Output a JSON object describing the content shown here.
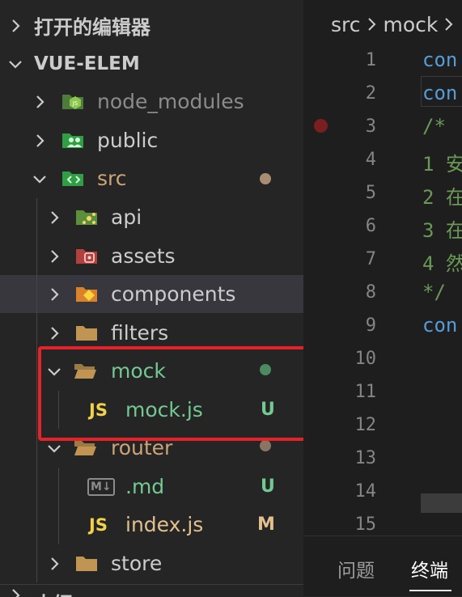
{
  "sidebar": {
    "open_editors_label": "打开的编辑器",
    "project_label": "VUE-ELEM",
    "outline_label": "大纲",
    "items": [
      {
        "label": "node_modules",
        "color": "#8b8b8b"
      },
      {
        "label": "public",
        "color": "#cccccc"
      },
      {
        "label": "src",
        "color": "#cca477"
      },
      {
        "label": "api",
        "color": "#cccccc"
      },
      {
        "label": "assets",
        "color": "#cccccc"
      },
      {
        "label": "components",
        "color": "#cccccc"
      },
      {
        "label": "filters",
        "color": "#cccccc"
      },
      {
        "label": "mock",
        "color": "#73c991"
      },
      {
        "label": "mock.js",
        "color": "#73c991",
        "icon_text": "JS",
        "status": "U"
      },
      {
        "label": "router",
        "color": "#cca477"
      },
      {
        "label": ".md",
        "color": "#73c991",
        "icon_text": "M↓",
        "status": "U"
      },
      {
        "label": "index.js",
        "color": "#e2c08d",
        "icon_text": "JS",
        "status": "M"
      },
      {
        "label": "store",
        "color": "#cccccc"
      }
    ]
  },
  "editor": {
    "breadcrumb": [
      "src",
      "mock"
    ],
    "line_numbers": [
      "1",
      "2",
      "3",
      "4",
      "5",
      "6",
      "7",
      "8",
      "9",
      "10",
      "11",
      "12",
      "13",
      "14",
      "15"
    ],
    "code_lines": [
      "con",
      "con",
      "/*",
      "1 安",
      "2 在",
      "3 在",
      "4 然",
      "*/",
      "con"
    ]
  },
  "panel": {
    "tabs": [
      "问题",
      "终端"
    ]
  },
  "colors": {
    "untracked": "#73c991",
    "modified": "#e2c08d",
    "highlight": "#e5212a",
    "folder": "#c09553"
  }
}
